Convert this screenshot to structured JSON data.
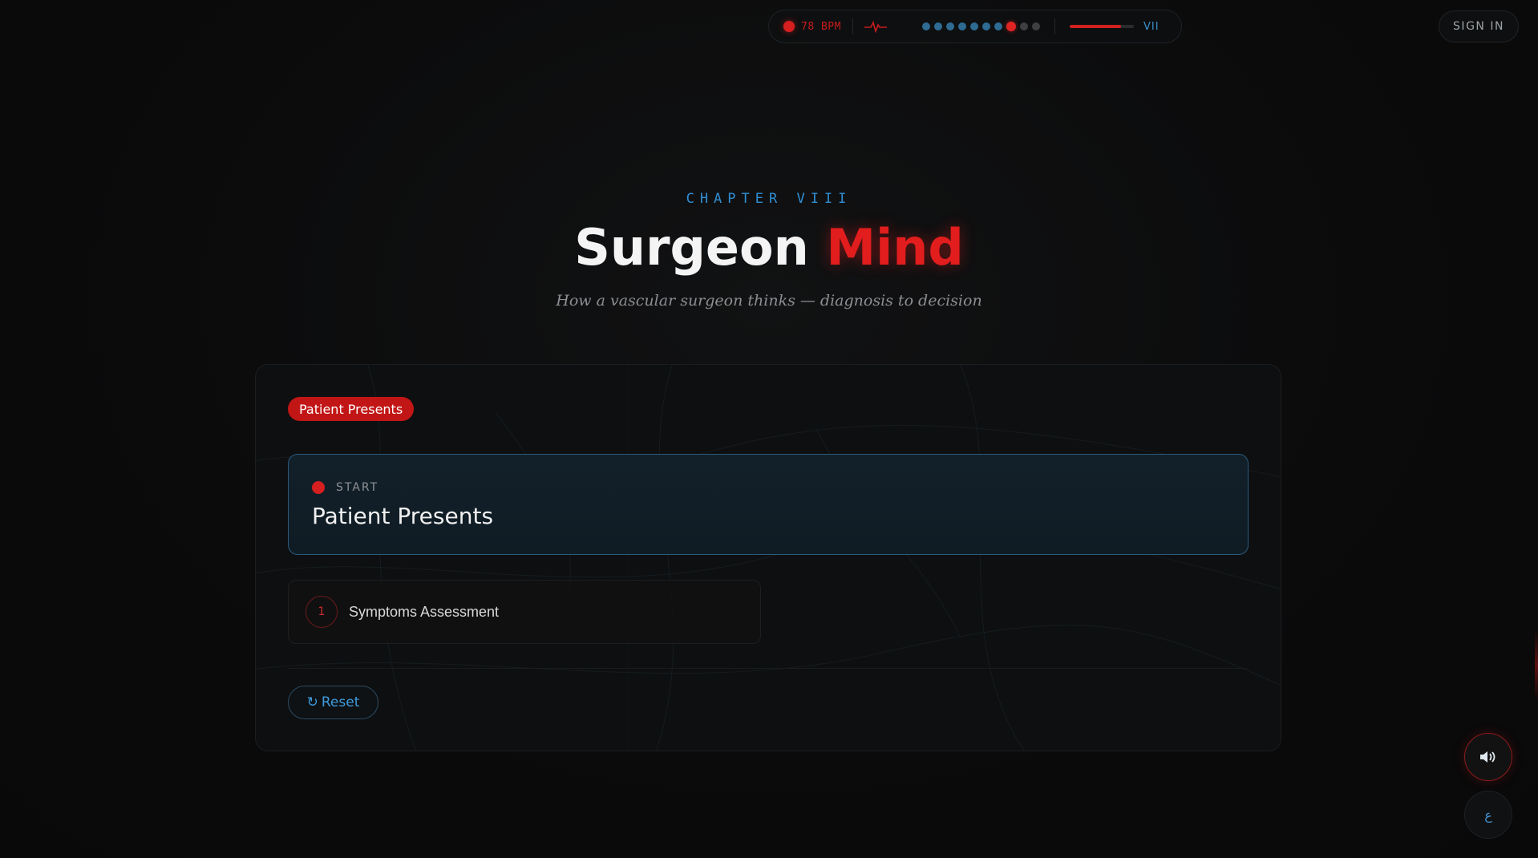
{
  "hud": {
    "bpm_label": "78 BPM",
    "chapter_numeral": "VII",
    "progress_fraction": 0.8,
    "dots": [
      "done",
      "done",
      "done",
      "done",
      "done",
      "done",
      "done",
      "active",
      "future",
      "future"
    ]
  },
  "nav": {
    "sign_in_label": "SIGN IN"
  },
  "hero": {
    "chapter": "CHAPTER VIII",
    "title_main": "Surgeon",
    "title_accent": "Mind",
    "subtitle": "How a vascular surgeon thinks — diagnosis to decision"
  },
  "panel": {
    "stage_label": "Patient Presents",
    "start_tag": "START",
    "start_title": "Patient Presents",
    "options": [
      {
        "number": "1",
        "label": "Symptoms Assessment"
      }
    ],
    "reset_icon": "↻",
    "reset_label": "Reset"
  },
  "controls": {
    "sound_icon": "speaker-icon",
    "lang_glyph": "ع"
  },
  "colors": {
    "accent_red": "#e21d1d",
    "accent_blue": "#2f8ed2",
    "background": "#0b0b0c"
  }
}
